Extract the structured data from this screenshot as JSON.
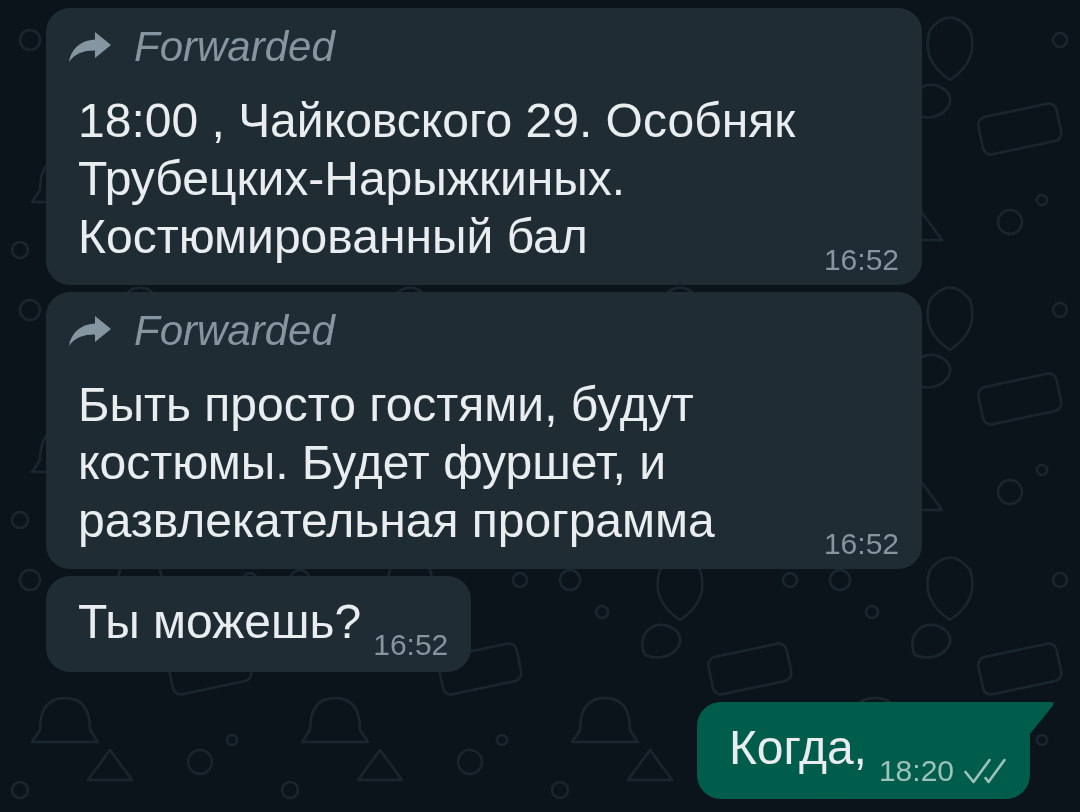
{
  "messages": [
    {
      "kind": "incoming",
      "forwarded_label": "Forwarded",
      "text": "18:00 , Чайковского 29. Особняк Трубецких-Нарыжкиных. Костюмированный бал",
      "time": "16:52"
    },
    {
      "kind": "incoming",
      "forwarded_label": "Forwarded",
      "text": "Быть просто гостями, будут костюмы. Будет фуршет, и развлекательная программа",
      "time": "16:52"
    },
    {
      "kind": "incoming",
      "text": "Ты можешь?",
      "time": "16:52"
    },
    {
      "kind": "outgoing",
      "text": "Когда,",
      "time": "18:20",
      "delivered": true,
      "read": false
    }
  ]
}
